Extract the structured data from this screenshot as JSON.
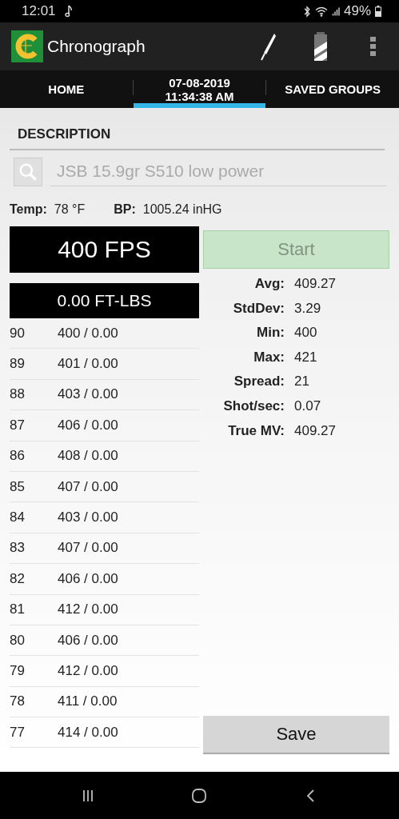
{
  "status_bar": {
    "time": "12:01",
    "battery": "49%"
  },
  "app_bar": {
    "title": "Chronograph"
  },
  "tabs": [
    {
      "label": "HOME",
      "selected": false
    },
    {
      "label": "07-08-2019\n11:34:38 AM",
      "selected": true
    },
    {
      "label": "SAVED GROUPS",
      "selected": false
    }
  ],
  "description": {
    "heading": "DESCRIPTION",
    "placeholder": "JSB 15.9gr S510 low power"
  },
  "conditions": [
    {
      "label": "Temp:",
      "value": "78 °F"
    },
    {
      "label": "BP:",
      "value": "1005.24 inHG"
    }
  ],
  "velocity": "400 FPS",
  "energy": "0.00 FT-LBS",
  "start_button": {
    "label": "Start",
    "disabled": true
  },
  "stats": [
    {
      "label": "Avg:",
      "value": "409.27"
    },
    {
      "label": "StdDev:",
      "value": "3.29"
    },
    {
      "label": "Min:",
      "value": "400"
    },
    {
      "label": "Max:",
      "value": "421"
    },
    {
      "label": "Spread:",
      "value": "21"
    },
    {
      "label": "Shot/sec:",
      "value": "0.07"
    },
    {
      "label": "True MV:",
      "value": "409.27"
    }
  ],
  "shots": [
    {
      "number": "90",
      "reading": "400 / 0.00"
    },
    {
      "number": "89",
      "reading": "401 / 0.00"
    },
    {
      "number": "88",
      "reading": "403 / 0.00"
    },
    {
      "number": "87",
      "reading": "406 / 0.00"
    },
    {
      "number": "86",
      "reading": "408 / 0.00"
    },
    {
      "number": "85",
      "reading": "407 / 0.00"
    },
    {
      "number": "84",
      "reading": "403 / 0.00"
    },
    {
      "number": "83",
      "reading": "407 / 0.00"
    },
    {
      "number": "82",
      "reading": "406 / 0.00"
    },
    {
      "number": "81",
      "reading": "412 / 0.00"
    },
    {
      "number": "80",
      "reading": "406 / 0.00"
    },
    {
      "number": "79",
      "reading": "412 / 0.00"
    },
    {
      "number": "78",
      "reading": "411 / 0.00"
    },
    {
      "number": "77",
      "reading": "414 / 0.00"
    }
  ],
  "save_button": {
    "label": "Save"
  }
}
